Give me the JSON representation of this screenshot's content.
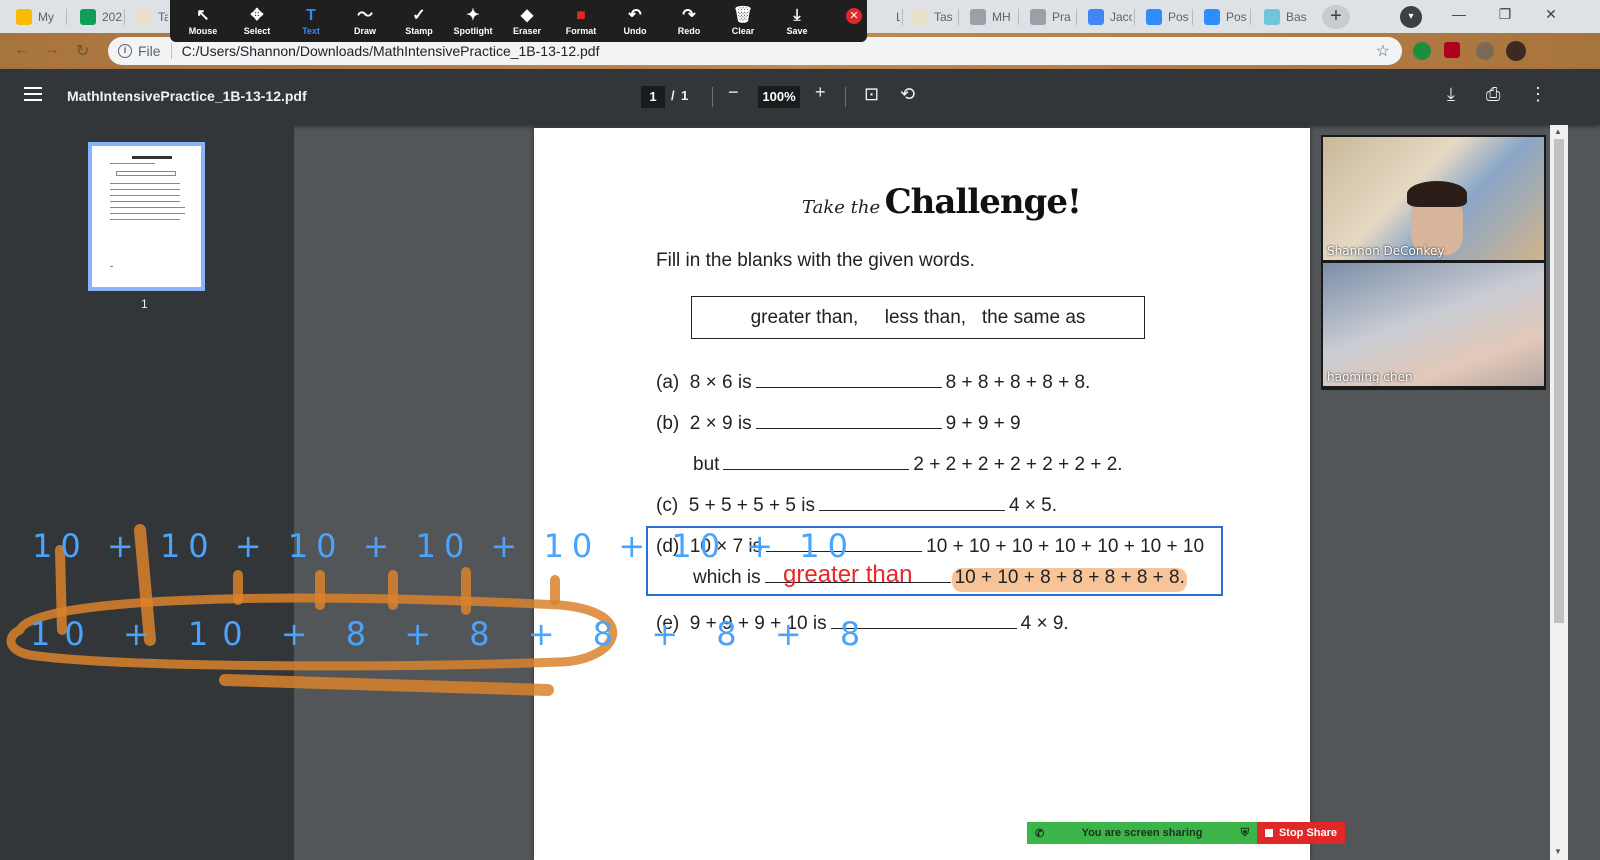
{
  "tabs": [
    {
      "label": "My",
      "color": "#fbbc04",
      "icon": "drive-icon"
    },
    {
      "label": "202",
      "color": "#0f9d58",
      "icon": "sheets-icon"
    },
    {
      "label": "Ta",
      "color": "#e8e0c8",
      "icon": "task-icon"
    },
    {
      "label": "Less",
      "color": "#dee1e6",
      "icon": "lesson-icon"
    },
    {
      "label": "Tas",
      "color": "#e8e0c8",
      "icon": "task-icon"
    },
    {
      "label": "MH",
      "color": "#9aa0a6",
      "icon": "web-icon"
    },
    {
      "label": "Pra",
      "color": "#9aa0a6",
      "icon": "web-icon"
    },
    {
      "label": "Jacc",
      "color": "#4285f4",
      "icon": "docs-icon"
    },
    {
      "label": "Pos",
      "color": "#2d8cff",
      "icon": "zoom-icon"
    },
    {
      "label": "Pos",
      "color": "#2d8cff",
      "icon": "zoom-icon"
    },
    {
      "label": "Bas",
      "color": "#6ec6d8",
      "icon": "bot-icon"
    }
  ],
  "annotation_toolbar": {
    "tools": [
      {
        "label": "Mouse",
        "icon": "↖",
        "name": "mouse"
      },
      {
        "label": "Select",
        "icon": "✥",
        "name": "select"
      },
      {
        "label": "Text",
        "icon": "T",
        "name": "text",
        "active": true
      },
      {
        "label": "Draw",
        "icon": "〜",
        "name": "draw"
      },
      {
        "label": "Stamp",
        "icon": "✓",
        "name": "stamp"
      },
      {
        "label": "Spotlight",
        "icon": "✦",
        "name": "spotlight"
      },
      {
        "label": "Eraser",
        "icon": "◆",
        "name": "eraser"
      },
      {
        "label": "Format",
        "icon": "■",
        "name": "format"
      },
      {
        "label": "Undo",
        "icon": "↶",
        "name": "undo"
      },
      {
        "label": "Redo",
        "icon": "↷",
        "name": "redo"
      },
      {
        "label": "Clear",
        "icon": "🗑",
        "name": "clear"
      },
      {
        "label": "Save",
        "icon": "⤓",
        "name": "save"
      }
    ],
    "format_color": "#e02828"
  },
  "address": {
    "scheme_label": "File",
    "url": "C:/Users/Shannon/Downloads/MathIntensivePractice_1B-13-12.pdf"
  },
  "pdf": {
    "title": "MathIntensivePractice_1B-13-12.pdf",
    "page_current": "1",
    "page_sep": "/",
    "page_total": "1",
    "zoom": "100%",
    "thumb_label": "1"
  },
  "worksheet": {
    "take_the": "Take the",
    "challenge": "Challenge!",
    "instruction": "Fill in the blanks with the given words.",
    "words": "greater than,     less than,   the same as",
    "questions": {
      "a_label": "(a)",
      "a_left": "8 × 6 is",
      "a_right": "8 + 8 + 8 + 8 + 8.",
      "b_label": "(b)",
      "b_left": "2 × 9 is",
      "b_right": "9 + 9 + 9",
      "b2_left": "but",
      "b2_right": "2 + 2 + 2 + 2 + 2 + 2 + 2.",
      "c_label": "(c)",
      "c_left": "5 + 5 + 5 + 5 is",
      "c_right": "4 × 5.",
      "d_label": "(d)",
      "d_left": "10 × 7 is",
      "d_right": "10 + 10 + 10 + 10 + 10 + 10 + 10",
      "d2_left": "which is",
      "d2_right": "10 + 10 + 8 + 8 + 8 + 8 + 8.",
      "e_label": "(e)",
      "e_left": "9 + 9 + 9 + 10 is",
      "e_right": "4 × 9."
    },
    "typed_answer": "greater than",
    "answer_color": "#e5262b",
    "box_color": "#2a6fd4"
  },
  "ink": {
    "top_row": "10 + 10 + 10 + 10 + 10 + 10 + 10",
    "bottom_row": "10 + 10 + 8 + 8 + 8 + 8 + 8",
    "blue": "#4aa3ff",
    "orange": "#d9822b"
  },
  "participants": [
    {
      "name": "Shannon DeConkey"
    },
    {
      "name": "haoming chen"
    }
  ],
  "share": {
    "status": "You are screen sharing",
    "stop": "Stop Share"
  }
}
